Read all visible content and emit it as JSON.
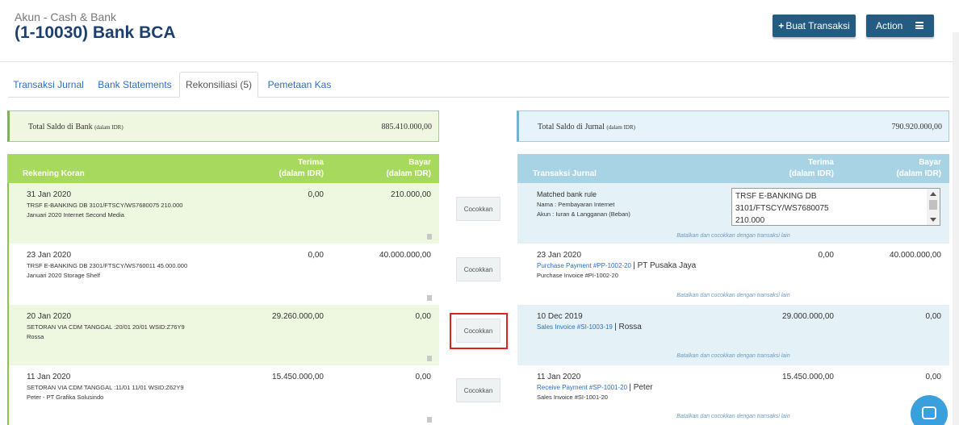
{
  "header": {
    "subtitle": "Akun - Cash & Bank",
    "title": "(1-10030) Bank BCA",
    "buat_transaksi": "Buat Transaksi",
    "action": "Action"
  },
  "tabs": [
    "Transaksi Jurnal",
    "Bank Statements",
    "Rekonsiliasi (5)",
    "Pemetaan Kas"
  ],
  "summary_left": {
    "label": "Total Saldo di Bank",
    "unit": "(dalam IDR)",
    "value": "885.410.000,00"
  },
  "summary_right": {
    "label": "Total Saldo di Jurnal",
    "unit": "(dalam IDR)",
    "value": "790.920.000,00"
  },
  "left_head": {
    "title": "Rekening Koran",
    "col1": "Terima",
    "col2": "Bayar",
    "unit": "(dalam IDR)"
  },
  "right_head": {
    "title": "Transaksi Jurnal",
    "col1": "Terima",
    "col2": "Bayar",
    "unit": "(dalam IDR)"
  },
  "match_label": "Cocokkan",
  "cancel_label": "Batalkan dan cocokkan dengan transaksi lain",
  "left_rows": [
    {
      "date": "31 Jan 2020",
      "line1": "TRSF E-BANKING DB 3101/FTSCY/WS7680075 210.000",
      "line2": "Januari 2020 Internet Second Media",
      "terima": "0,00",
      "bayar": "210.000,00"
    },
    {
      "date": "23 Jan 2020",
      "line1": "TRSF E-BANKING DB 2301/FTSCY/WS760011 45.000.000",
      "line2": "Januari 2020 Storage Shelf",
      "terima": "0,00",
      "bayar": "40.000.000,00"
    },
    {
      "date": "20 Jan 2020",
      "line1": "SETORAN VIA CDM TANGGAL :20/01 20/01 WSID:Z76Y9",
      "line2": "Rossa",
      "terima": "29.260.000,00",
      "bayar": "0,00"
    },
    {
      "date": "11 Jan 2020",
      "line1": "SETORAN VIA CDM TANGGAL :11/01 11/01 WSID:Z62Y9",
      "line2": "Peter - PT Grafika Solusindo",
      "terima": "15.450.000,00",
      "bayar": "0,00"
    }
  ],
  "rule_row": {
    "title": "Matched bank rule",
    "nama": "Nama : Pembayaran Internet",
    "akun": "Akun : Iuran & Langganan (Beban)",
    "box_line1": "TRSF E-BANKING DB",
    "box_line2": "3101/FTSCY/WS7680075",
    "box_line3": "210.000"
  },
  "right_rows": [
    {
      "date": "23 Jan 2020",
      "link": "Purchase Payment #PP-1002-20",
      "party": "PT Pusaka Jaya",
      "invoice": "Purchase Invoice #PI-1002-20",
      "terima": "0,00",
      "bayar": "40.000.000,00"
    },
    {
      "date": "10 Dec 2019",
      "link": "Sales Invoice #SI-1003-19",
      "party": "Rossa",
      "invoice": "",
      "terima": "29.000.000,00",
      "bayar": "0,00"
    },
    {
      "date": "11 Jan 2020",
      "link": "Receive Payment #SP-1001-20",
      "party": "Peter",
      "invoice": "Sales Invoice #SI-1001-20",
      "terima": "15.450.000,00",
      "bayar": "0,00"
    }
  ]
}
